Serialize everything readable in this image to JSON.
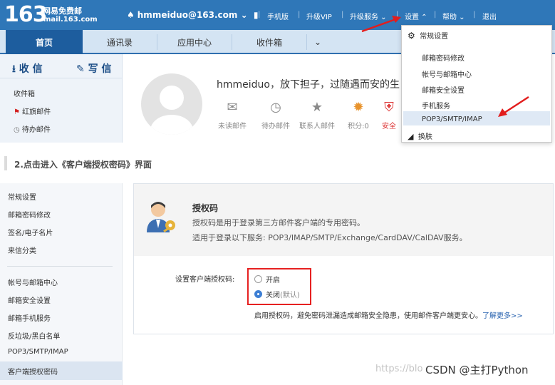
{
  "panel1": {
    "logo": {
      "number": "163",
      "line1": "网易免费邮",
      "line2": "mail.163.com"
    },
    "account": "hmmeiduo@163.com",
    "nav": [
      "手机版",
      "升级VIP",
      "升级服务",
      "设置",
      "帮助",
      "退出"
    ],
    "tabs": [
      "首页",
      "通讯录",
      "应用中心",
      "收件箱"
    ],
    "compose": {
      "receive": "收 信",
      "write": "写 信"
    },
    "left_menu": [
      "收件箱",
      "红旗邮件",
      "待办邮件"
    ],
    "greeting": "hmmeiduo，放下担子，过随遇而安的生",
    "stats": [
      "未读邮件",
      "待办邮件",
      "联系人邮件",
      "积分:0",
      "安全"
    ],
    "settings_menu": [
      "常规设置",
      "邮箱密码修改",
      "帐号与邮箱中心",
      "邮箱安全设置",
      "手机服务",
      "POP3/SMTP/IMAP",
      "换肤"
    ]
  },
  "step_heading": "2.点击进入《客户端授权密码》界面",
  "panel2": {
    "sidebar": [
      "常规设置",
      "邮箱密码修改",
      "签名/电子名片",
      "来信分类",
      "帐号与邮箱中心",
      "邮箱安全设置",
      "邮箱手机服务",
      "反垃圾/黑白名单",
      "POP3/SMTP/IMAP",
      "客户端授权密码"
    ],
    "title": "授权码",
    "desc1": "授权码是用于登录第三方邮件客户端的专用密码。",
    "desc2": "适用于登录以下服务: POP3/IMAP/SMTP/Exchange/CardDAV/CalDAV服务。",
    "setting_label": "设置客户端授权码:",
    "option_on": "开启",
    "option_off": "关闭",
    "option_default": "(默认)",
    "selected": "关闭",
    "note": "启用授权码，避免密码泄漏造成邮箱安全隐患，使用邮件客户端更安心。",
    "learn_more": "了解更多>>"
  },
  "watermark": {
    "url": "https://blo",
    "text": "CSDN @主打Python"
  },
  "colors": {
    "header": "#2f77b8",
    "accent": "#1d5d9e",
    "highlight_box": "#e62121"
  }
}
